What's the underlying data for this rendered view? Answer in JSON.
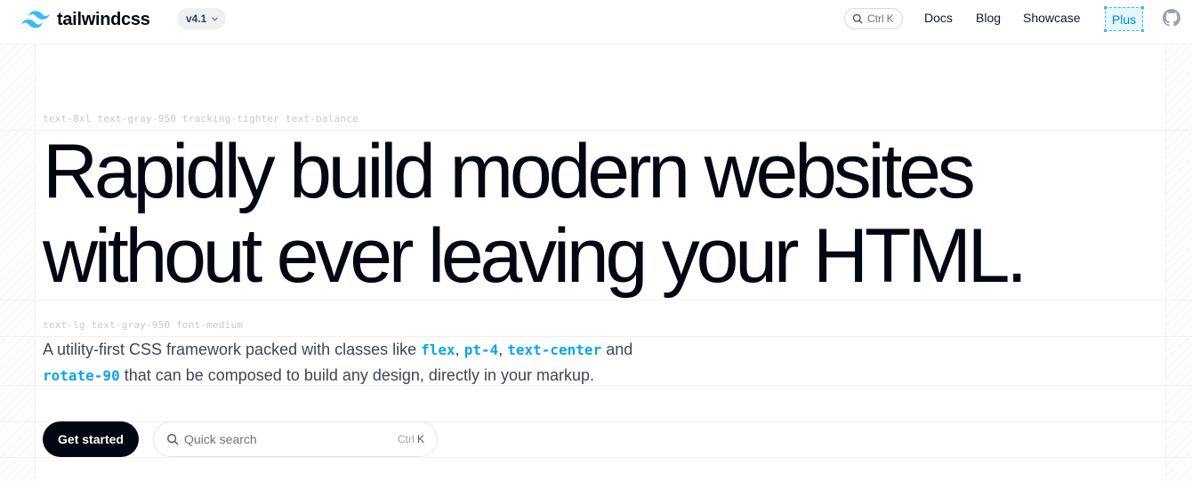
{
  "header": {
    "logo_text": "tailwindcss",
    "version": "v4.1",
    "search_shortcut_ctrl": "Ctrl",
    "search_shortcut_key": "K",
    "nav": {
      "docs": "Docs",
      "blog": "Blog",
      "showcase": "Showcase",
      "plus": "Plus"
    },
    "github_icon": "github-icon"
  },
  "hero": {
    "annotation_headline": "text-8xl text-gray-950 tracking-tighter text-balance",
    "headline_line1": "Rapidly build modern websites",
    "headline_line2": "without ever leaving your HTML.",
    "annotation_lead": "text-lg text-gray-950 font-medium",
    "lead": {
      "t1": "A utility-first CSS framework packed with classes like ",
      "c1": "flex",
      "t2": ", ",
      "c2": "pt-4",
      "t3": ", ",
      "c3": "text-center",
      "t4": " and",
      "c4": "rotate-90",
      "t5": " that can be composed to build any design, directly in your markup."
    }
  },
  "cta": {
    "get_started": "Get started",
    "search_placeholder": "Quick search",
    "search_ctrl": "Ctrl",
    "search_key": "K"
  },
  "colors": {
    "accent": "#0ea5e9",
    "text": "#030712",
    "plus_bg": "#e6f6fd"
  }
}
